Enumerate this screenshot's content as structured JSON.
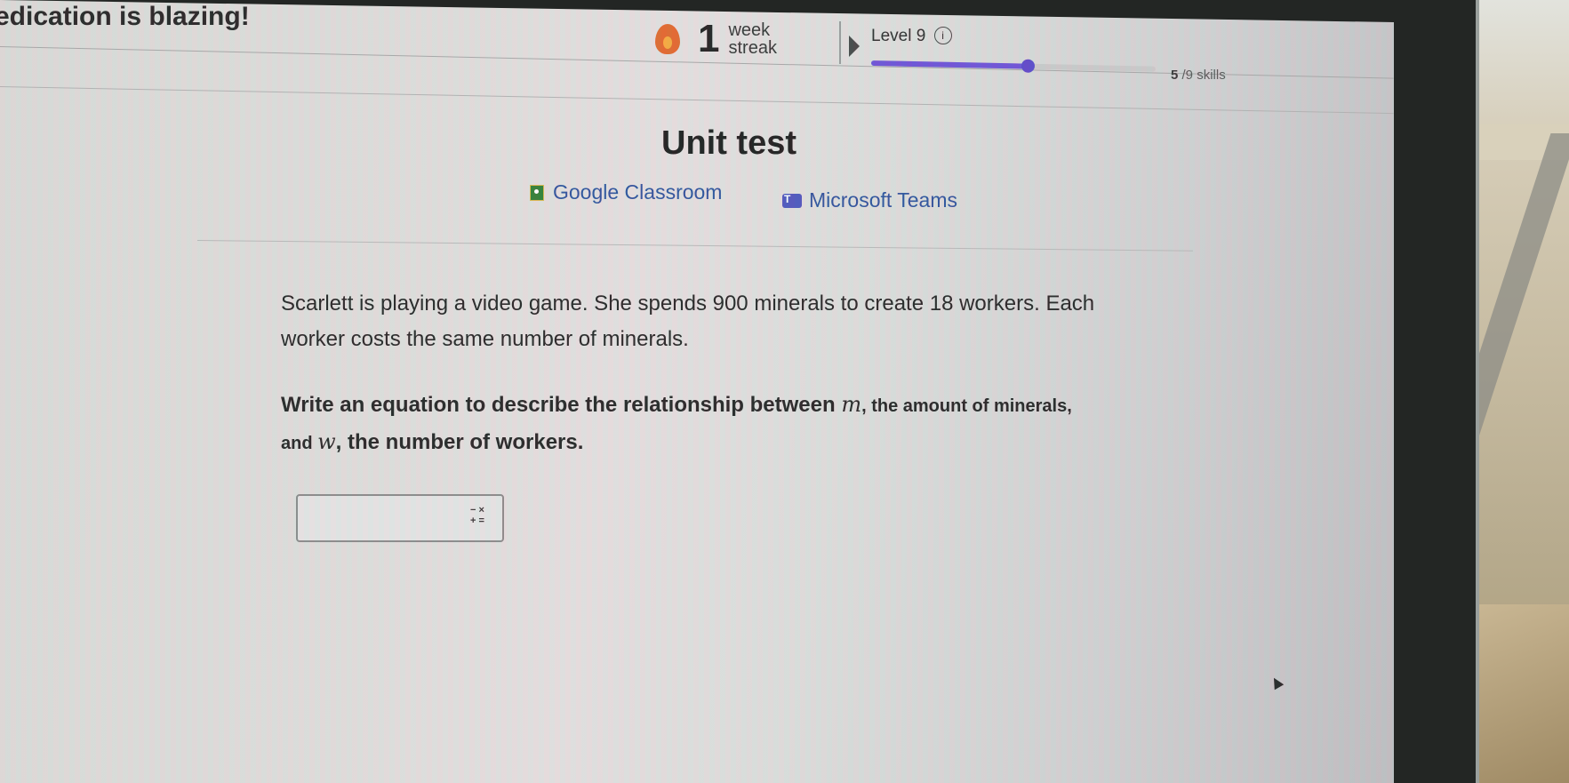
{
  "header": {
    "banner": "edication is blazing!",
    "streak": {
      "count": "1",
      "label_line1": "week",
      "label_line2": "streak"
    },
    "level": {
      "label": "Level 9",
      "info_icon": "ⓘ"
    },
    "progress": {
      "skills_done": "5",
      "skills_total_text": "/9 skills",
      "fraction": 0.55,
      "color": "#6a4fd6"
    }
  },
  "main": {
    "title": "Unit test",
    "share": [
      {
        "label": "Google Classroom",
        "icon": "google-classroom-icon"
      },
      {
        "label": "Microsoft Teams",
        "icon": "microsoft-teams-icon"
      }
    ],
    "question": {
      "paragraph1": "Scarlett is playing a video game. She spends 900 minerals to create 18 workers. Each worker costs the same number of minerals.",
      "p2_part1": "Write an equation to describe the relationship between ",
      "var_m": "m",
      "p2_part2": ", the amount of minerals, and ",
      "var_w": "w",
      "p2_part3": ", the number of workers."
    },
    "answer": {
      "value": "",
      "math_keys": [
        "−",
        "×",
        "+",
        "="
      ]
    }
  }
}
